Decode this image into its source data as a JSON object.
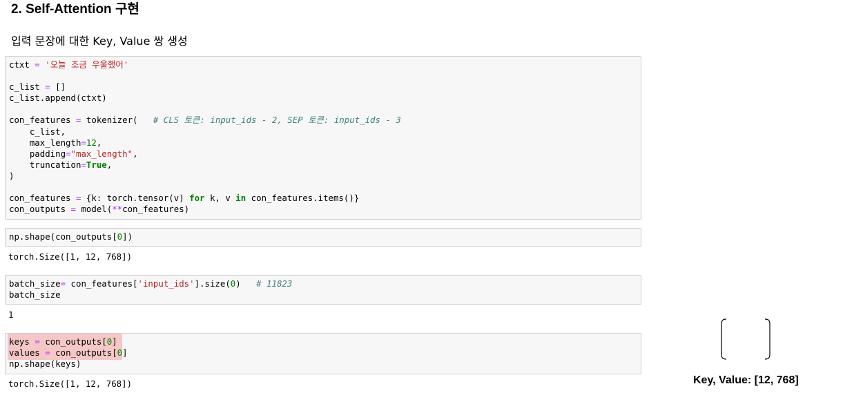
{
  "section_title": "2. Self-Attention 구현",
  "subtitle": "입력 문장에 대한 Key, Value 쌍 생성",
  "cell1": {
    "l1_var": "ctxt",
    "l1_op": " = ",
    "l1_str": "'오늘 조금 우울했어'",
    "l3_a": "c_list ",
    "l3_op": "=",
    "l3_b": " []",
    "l4": "c_list.append(ctxt)",
    "l6_a": "con_features ",
    "l6_op": "=",
    "l6_b": " tokenizer(   ",
    "l6_cmt": "# CLS 토큰: input_ids - 2, SEP 토큰: input_ids - 3",
    "l7": "    c_list,",
    "l8_a": "    max_length",
    "l8_op": "=",
    "l8_num": "12",
    "l8_b": ",",
    "l9_a": "    padding",
    "l9_op": "=",
    "l9_str": "\"max_length\"",
    "l9_b": ",",
    "l10_a": "    truncation",
    "l10_op": "=",
    "l10_kw": "True",
    "l10_b": ",",
    "l11": ")",
    "l13_a": "con_features ",
    "l13_op": "=",
    "l13_b": " {k: torch.tensor(v) ",
    "l13_kw1": "for",
    "l13_c": " k, v ",
    "l13_kw2": "in",
    "l13_d": " con_features.items()}",
    "l14_a": "con_outputs ",
    "l14_op": "=",
    "l14_b": " model(",
    "l14_op2": "**",
    "l14_c": "con_features)"
  },
  "cell2": {
    "a": "np.shape(con_outputs[",
    "num": "0",
    "b": "])",
    "output": "torch.Size([1, 12, 768])"
  },
  "cell3": {
    "l1_a": "batch_size",
    "l1_op": "=",
    "l1_b": " con_features[",
    "l1_str": "'input_ids'",
    "l1_c": "].size(",
    "l1_num": "0",
    "l1_d": ")   ",
    "l1_cmt": "# 11823",
    "l2": "batch_size",
    "output": "1"
  },
  "cell4": {
    "l1_a": "keys ",
    "l1_op": "=",
    "l1_b": " con_outputs[",
    "l1_num": "0",
    "l1_c": "]",
    "l2_a": "values ",
    "l2_op": "=",
    "l2_b": " con_outputs[",
    "l2_num": "0",
    "l2_c": "]",
    "l3": "np.shape(keys)",
    "output": "torch.Size([1, 12, 768])"
  },
  "annotation": {
    "label": "Key, Value: [12, 768]"
  }
}
